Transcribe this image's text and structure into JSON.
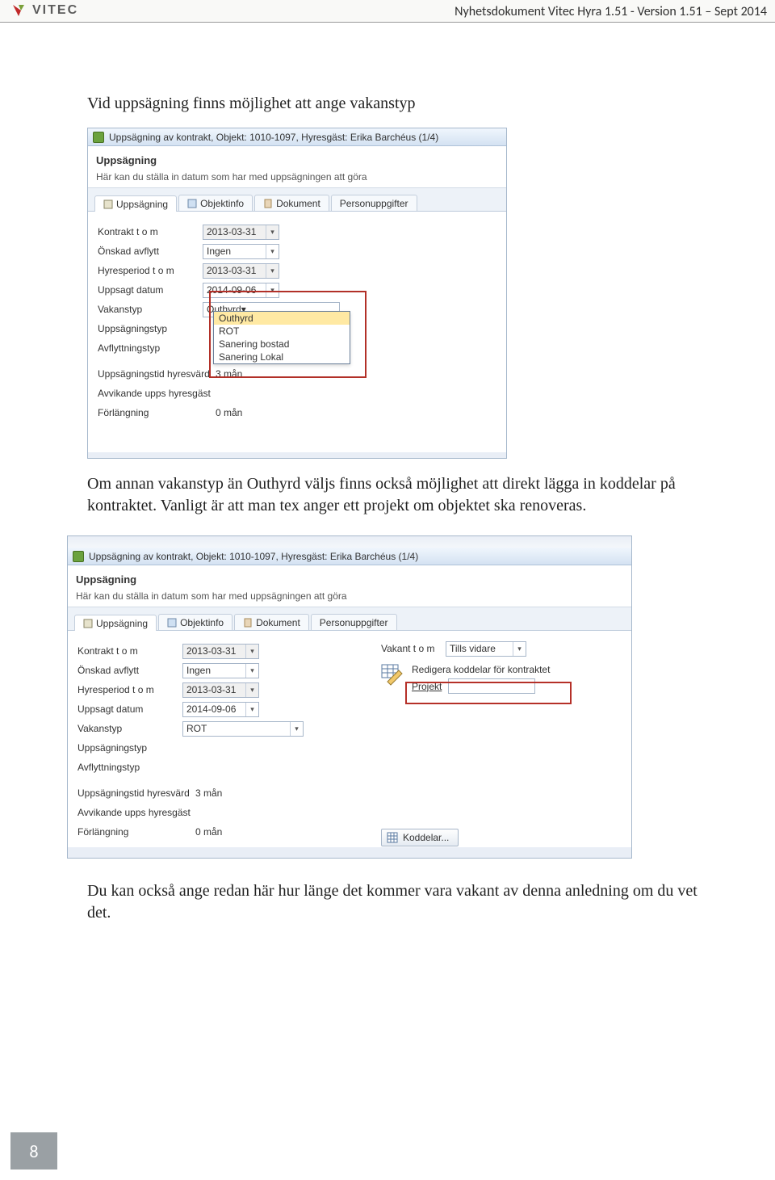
{
  "header": {
    "brand": "VITEC",
    "doc_title": "Nyhetsdokument Vitec Hyra 1.51 - Version 1.51 – Sept 2014"
  },
  "paragraphs": {
    "p1": "Vid uppsägning finns möjlighet att ange vakanstyp",
    "p2": "Om annan vakanstyp än Outhyrd väljs finns också möjlighet att direkt lägga in koddelar på kontraktet. Vanligt är att man tex anger ett projekt om objektet ska renoveras.",
    "p3": "Du kan också ange redan här hur länge det kommer vara vakant av denna anledning om du vet det."
  },
  "win1": {
    "title": "Uppsägning av kontrakt, Objekt: 1010-1097, Hyresgäst: Erika Barchéus (1/4)",
    "section_title": "Uppsägning",
    "section_sub": "Här kan du ställa in datum som har med uppsägningen att göra",
    "tabs": [
      "Uppsägning",
      "Objektinfo",
      "Dokument",
      "Personuppgifter"
    ],
    "labels": {
      "kontrakt": "Kontrakt t o m",
      "onskad": "Önskad avflytt",
      "hyres": "Hyresperiod t o m",
      "uppsagt": "Uppsagt datum",
      "vakanstyp": "Vakanstyp",
      "uppsagningstyp": "Uppsägningstyp",
      "avflytt": "Avflyttningstyp",
      "uppstid": "Uppsägningstid hyresvärd",
      "avvik": "Avvikande upps hyresgäst",
      "forlang": "Förlängning"
    },
    "values": {
      "kontrakt": "2013-03-31",
      "onskad": "Ingen",
      "hyres": "2013-03-31",
      "uppsagt": "2014-09-06",
      "vakanstyp": "Outhyrd",
      "uppstid": "3 mån",
      "forlang": "0 mån"
    },
    "dropdown": [
      "Outhyrd",
      "ROT",
      "Sanering bostad",
      "Sanering Lokal"
    ]
  },
  "win2": {
    "title": "Uppsägning av kontrakt, Objekt: 1010-1097, Hyresgäst: Erika Barchéus (1/4)",
    "section_title": "Uppsägning",
    "section_sub": "Här kan du ställa in datum som har med uppsägningen att göra",
    "tabs": [
      "Uppsägning",
      "Objektinfo",
      "Dokument",
      "Personuppgifter"
    ],
    "labels": {
      "kontrakt": "Kontrakt t o m",
      "onskad": "Önskad avflytt",
      "hyres": "Hyresperiod t o m",
      "uppsagt": "Uppsagt datum",
      "vakanstyp": "Vakanstyp",
      "uppsagningstyp": "Uppsägningstyp",
      "avflytt": "Avflyttningstyp",
      "uppstid": "Uppsägningstid hyresvärd",
      "avvik": "Avvikande upps hyresgäst",
      "forlang": "Förlängning",
      "vakant_tom": "Vakant t o m",
      "redigera": "Redigera koddelar för kontraktet",
      "projekt": "Projekt",
      "koddelar_btn": "Koddelar..."
    },
    "values": {
      "kontrakt": "2013-03-31",
      "onskad": "Ingen",
      "hyres": "2013-03-31",
      "uppsagt": "2014-09-06",
      "vakanstyp": "ROT",
      "vakant_tom": "Tills vidare",
      "uppstid": "3 mån",
      "forlang": "0 mån"
    }
  },
  "page_number": "8"
}
